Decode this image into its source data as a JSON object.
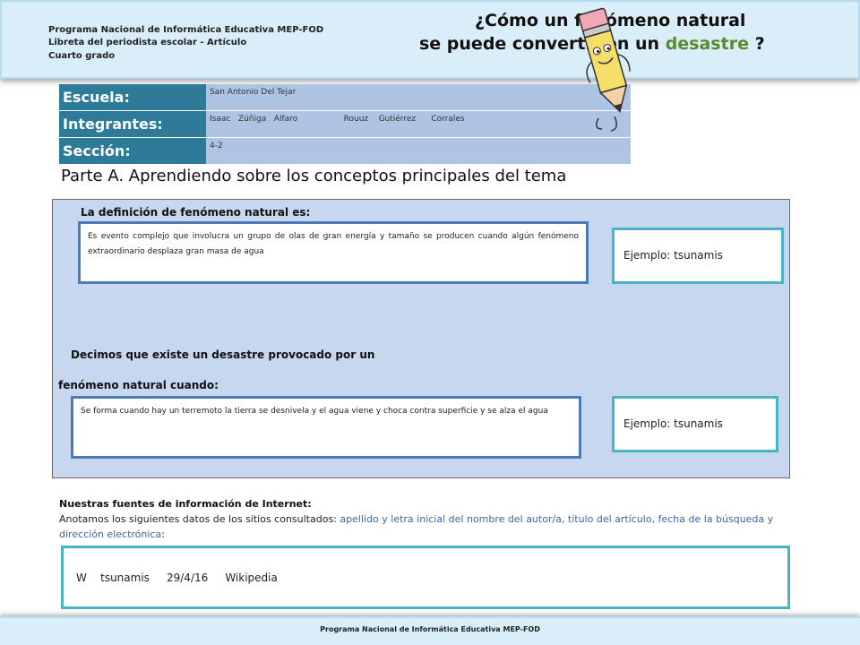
{
  "header": {
    "line1": "Programa Nacional de Informática Educativa MEP-FOD",
    "line2": "Libreta del periodista escolar -  Artículo",
    "line3": "Cuarto grado",
    "title_line1": "¿Cómo un fenómeno natural",
    "title_line2_pre": "se puede convertir en un ",
    "title_line2_highlight": "desastre",
    "title_line2_post": " ?"
  },
  "info": {
    "school_label": "Escuela:",
    "school_value": "San Antonio Del Tejar",
    "members_label": "Integrantes:",
    "members_value": "Isaac   Zúñiga   Alfaro                  Rouuz    Gutiérrez      Corrales",
    "section_label": "Sección:",
    "section_value": "4-2"
  },
  "part_a_title": "Parte A.  Aprendiendo sobre los conceptos principales del tema",
  "definition": {
    "label": "La definición de  fenómeno natural es:",
    "text": "Es evento  complejo que involucra un grupo de olas de gran energía y tamaño se producen cuando algún  fenómeno  extraordinario desplaza gran masa de agua",
    "example": "Ejemplo: tsunamis"
  },
  "disaster": {
    "label_line1": "Decimos que existe un desastre provocado por un",
    "label_line2": "fenómeno natural cuando:",
    "text": "Se forma cuando hay un terremoto  la tierra se desnivela y el agua viene y choca contra superficie y se alza el agua",
    "example": "Ejemplo:  tsunamis"
  },
  "sources": {
    "title": "Nuestras fuentes de información de Internet:",
    "desc_pre": "Anotamos los siguientes datos de los sitios consultados: ",
    "desc_blue": "apellido y letra inicial del nombre del autor/a,  título del artículo, fecha de la búsqueda y dirección electrónica",
    "desc_post": ":",
    "entry": "W    tsunamis     29/4/16     Wikipedia"
  },
  "footer": {
    "text": "Programa  Nacional de Informática  Educativa MEP-FOD"
  },
  "colors": {
    "header_bg": "#d9eef8",
    "label_bg": "#2e7a99",
    "value_bg": "#aec4e3",
    "panel_bg": "#c6d7ef",
    "highlight_green": "#5a8a2e",
    "link_blue": "#3b66a8"
  },
  "icons": {
    "mascot": "pencil-mascot-icon"
  }
}
